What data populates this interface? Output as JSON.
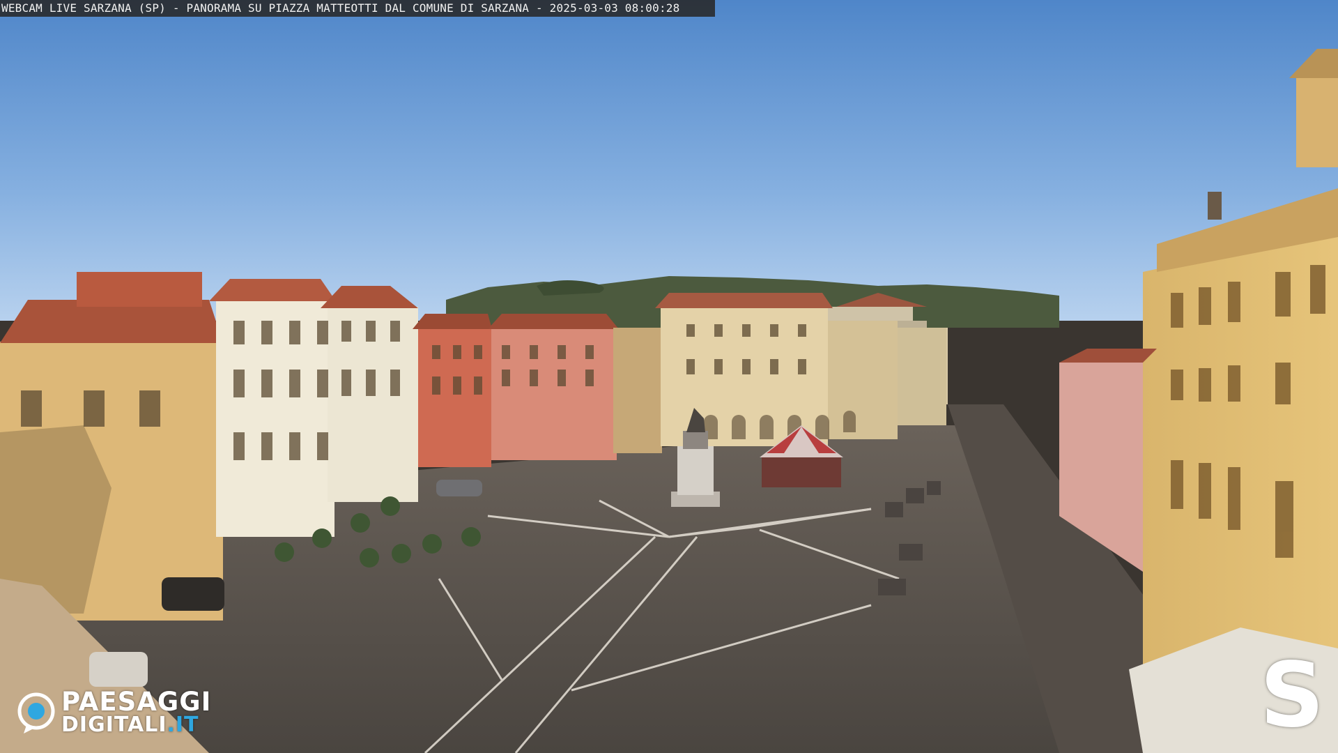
{
  "overlay": {
    "caption": "WEBCAM LIVE SARZANA (SP) - PANORAMA SU PIAZZA MATTEOTTI DAL COMUNE DI SARZANA - 2025-03-03  08:00:28"
  },
  "watermark_left": {
    "line1": "PAESAGGI",
    "line2": "DIGITALI",
    "line2_suffix": ".IT",
    "icon": "camera-lens-icon"
  },
  "watermark_right": {
    "letter": "S"
  },
  "colors": {
    "sky_top": "#5a8fcd",
    "sky_bottom": "#a9c9ea",
    "paving": "#5b544e",
    "accent_blue": "#2fa7e0",
    "roof_terracotta": "#a4503a"
  }
}
